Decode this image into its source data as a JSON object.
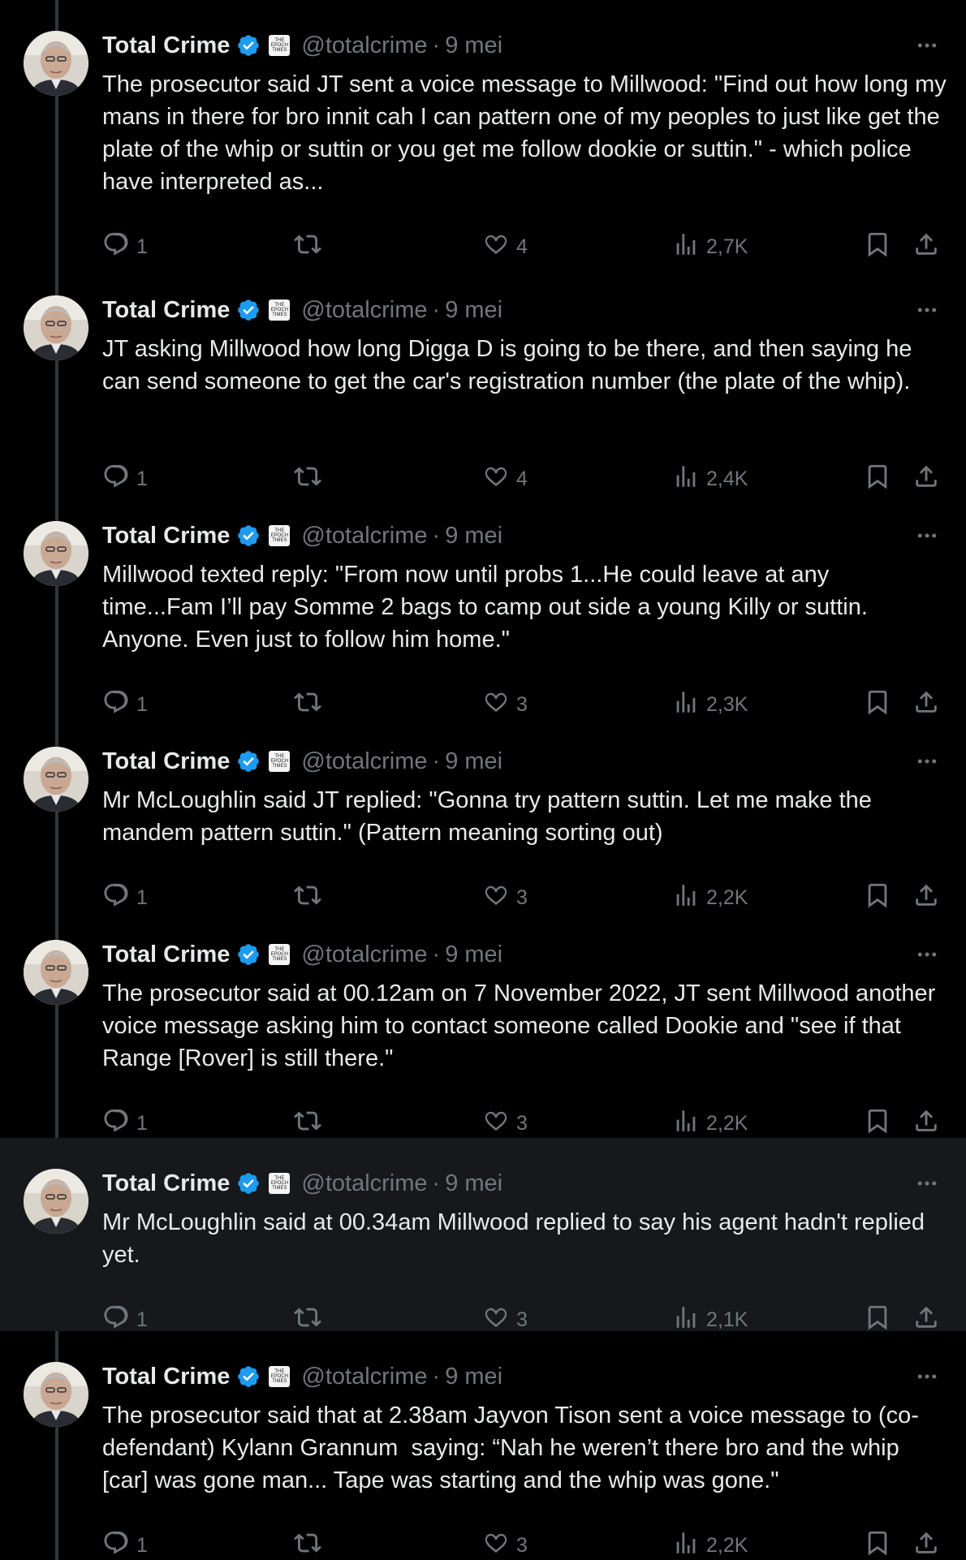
{
  "colors": {
    "background": "#000000",
    "text": "#e7e9ea",
    "muted": "#71767b",
    "verified": "#1d9bf0",
    "thread_line": "#333639",
    "highlight": "#16181c"
  },
  "author": {
    "name": "Total Crime",
    "handle": "@totalcrime",
    "separator": "·",
    "publication_badge": [
      "THE",
      "EPOCH",
      "TIMES"
    ]
  },
  "icons": {
    "more": "more-icon",
    "reply": "reply-icon",
    "retweet": "retweet-icon",
    "like": "heart-icon",
    "views": "views-icon",
    "bookmark": "bookmark-icon",
    "share": "share-icon"
  },
  "tweets": [
    {
      "time": "9 mei",
      "text": "The prosecutor said JT sent a voice message to Millwood: \"Find out how long my mans in there for bro innit cah I can pattern one of my peoples to just like get the plate of the whip or suttin or you get me follow dookie or suttin.\" - which police have interpreted as...",
      "replies": "1",
      "retweets": "",
      "likes": "4",
      "views": "2,7K"
    },
    {
      "time": "9 mei",
      "text": "JT asking Millwood how long Digga D is going to be there, and then saying he can send someone to get the car's registration number (the plate of the whip).",
      "replies": "1",
      "retweets": "",
      "likes": "4",
      "views": "2,4K"
    },
    {
      "time": "9 mei",
      "text": "Millwood texted reply: \"From now until probs 1...He could leave at any time...Fam I’ll pay Somme 2 bags to camp out side a young Killy or suttin. Anyone. Even just to follow him home.\"",
      "replies": "1",
      "retweets": "",
      "likes": "3",
      "views": "2,3K"
    },
    {
      "time": "9 mei",
      "text": "Mr McLoughlin said JT replied: \"Gonna try pattern suttin. Let me make the mandem pattern suttin.\" (Pattern meaning sorting out)",
      "replies": "1",
      "retweets": "",
      "likes": "3",
      "views": "2,2K"
    },
    {
      "time": "9 mei",
      "text": "The prosecutor said at 00.12am on 7 November 2022, JT sent Millwood another voice message asking him to contact someone called Dookie and \"see if that Range [Rover] is still there.\"",
      "replies": "1",
      "retweets": "",
      "likes": "3",
      "views": "2,2K"
    },
    {
      "time": "9 mei",
      "text": "Mr McLoughlin said at 00.34am Millwood replied to say his agent hadn't replied yet.",
      "replies": "1",
      "retweets": "",
      "likes": "3",
      "views": "2,1K"
    },
    {
      "time": "9 mei",
      "text": "The prosecutor said that at 2.38am Jayvon Tison sent a voice message to (co-defendant) Kylann Grannum  saying: “Nah he weren’t there bro and the whip [car] was gone man... Tape was starting and the whip was gone.\"",
      "replies": "1",
      "retweets": "",
      "likes": "3",
      "views": "2,2K"
    }
  ]
}
